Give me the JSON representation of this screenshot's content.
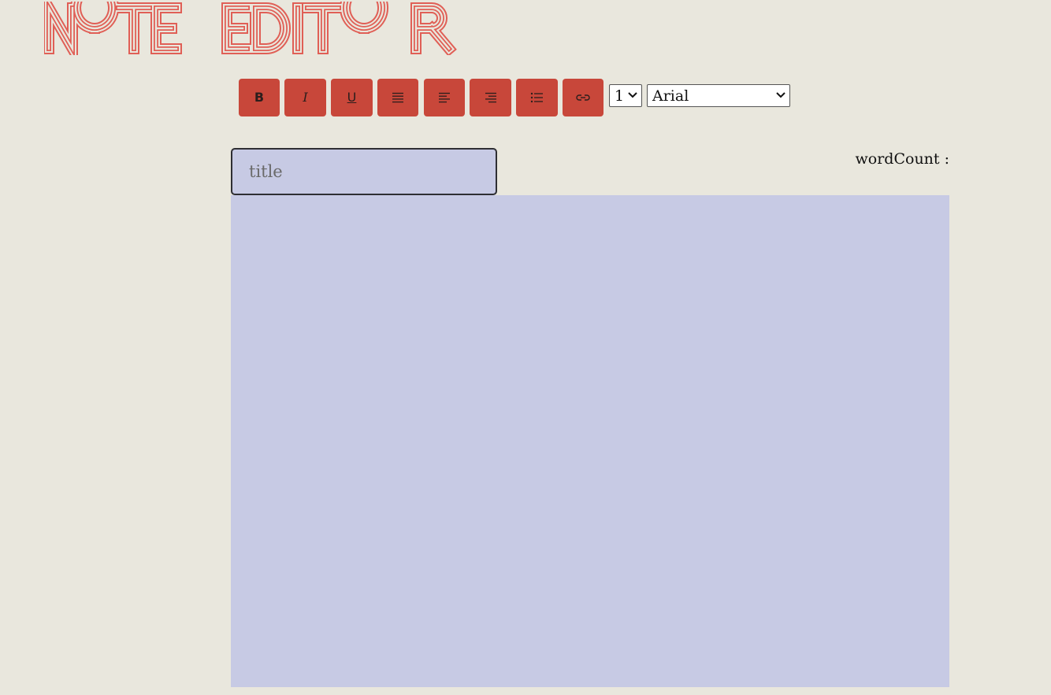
{
  "app": {
    "title": "NOTE EDITOR"
  },
  "colors": {
    "accent": "#c8473a",
    "logo": "#e05f56",
    "background": "#e9e7dd",
    "editor_bg": "#c7cae4"
  },
  "toolbar": {
    "buttons": [
      {
        "label": "B",
        "icon": "bold-icon"
      },
      {
        "label": "I",
        "icon": "italic-icon"
      },
      {
        "label": "U",
        "icon": "underline-icon"
      },
      {
        "icon": "align-justify-icon"
      },
      {
        "icon": "align-left-icon"
      },
      {
        "icon": "align-right-icon"
      },
      {
        "icon": "bullet-list-icon"
      },
      {
        "icon": "link-icon"
      }
    ],
    "font_size": {
      "selected": "1"
    },
    "font_family": {
      "selected": "Arial"
    }
  },
  "title_input": {
    "placeholder": "title",
    "value": ""
  },
  "word_count": {
    "label": "wordCount :"
  },
  "editor": {
    "content": ""
  }
}
